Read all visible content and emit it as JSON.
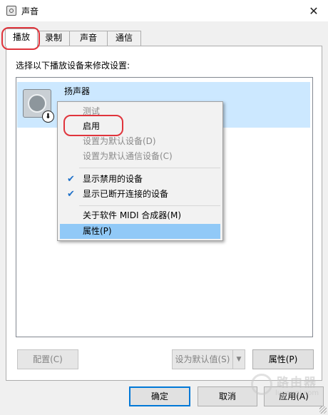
{
  "window": {
    "title": "声音",
    "close_glyph": "✕"
  },
  "tabs": [
    {
      "label": "播放",
      "active": true
    },
    {
      "label": "录制",
      "active": false
    },
    {
      "label": "声音",
      "active": false
    },
    {
      "label": "通信",
      "active": false
    }
  ],
  "instruction": "选择以下播放设备来修改设置:",
  "device": {
    "name": "扬声器",
    "status_icon": "disabled-arrow-icon",
    "badge_glyph": "⬇"
  },
  "context_menu": {
    "items": [
      {
        "label": "测试",
        "disabled": true
      },
      {
        "label": "启用",
        "disabled": false
      },
      {
        "label": "设置为默认设备(D)",
        "disabled": true
      },
      {
        "label": "设置为默认通信设备(C)",
        "disabled": true
      },
      {
        "label": "显示禁用的设备",
        "checked": true
      },
      {
        "label": "显示已断开连接的设备",
        "checked": true
      },
      {
        "label": "关于软件 MIDI 合成器(M)",
        "disabled": false
      },
      {
        "label": "属性(P)",
        "highlighted": true
      }
    ],
    "check_glyph": "✔"
  },
  "buttons": {
    "configure": "配置(C)",
    "set_default": "设为默认值(S)",
    "properties": "属性(P)",
    "ok": "确定",
    "cancel": "取消",
    "apply": "应用(A)"
  },
  "annotation_color": "#e0343c",
  "watermark": {
    "text": "路由器",
    "url": "luyouqi.com"
  }
}
